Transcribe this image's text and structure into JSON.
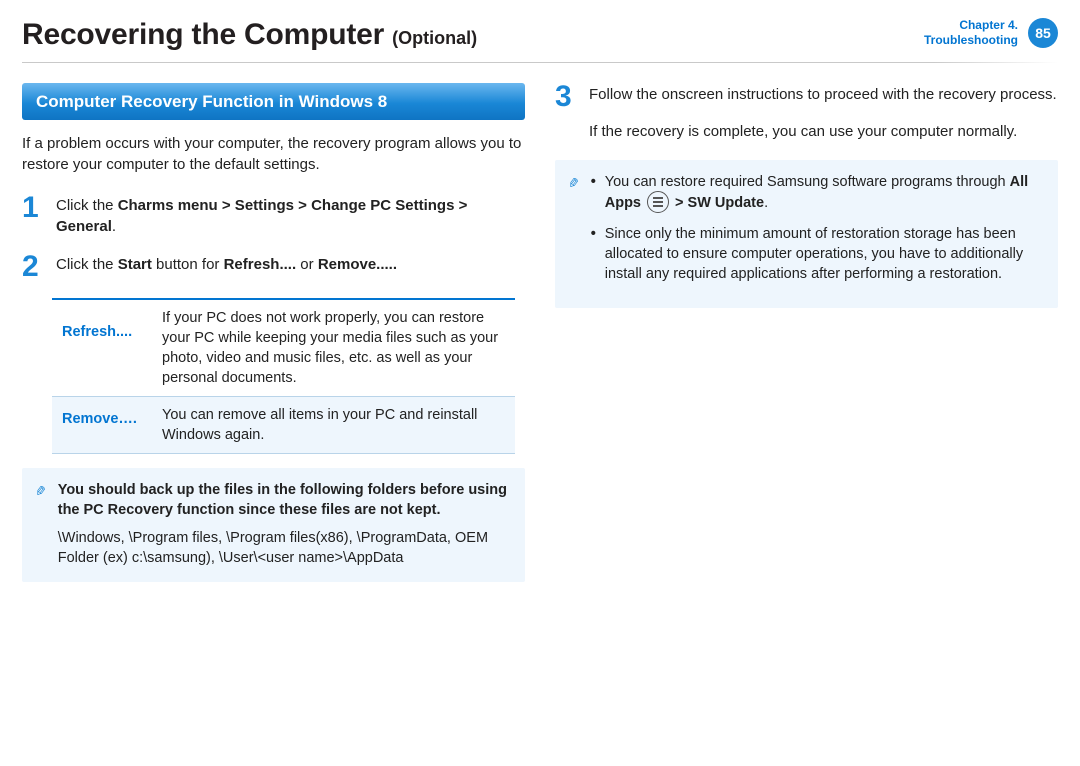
{
  "header": {
    "title": "Recovering the Computer",
    "subtitle": "(Optional)",
    "chapter_line1": "Chapter 4.",
    "chapter_line2": "Troubleshooting",
    "page_number": "85"
  },
  "left": {
    "banner": "Computer Recovery Function in Windows 8",
    "intro": "If a problem occurs with your computer, the recovery program allows you to restore your computer to the default settings.",
    "step1_pre": "Click the ",
    "step1_bold": "Charms menu > Settings > Change PC Settings > General",
    "step1_post": ".",
    "step2_pre": "Click the ",
    "step2_b1": "Start",
    "step2_mid1": " button for ",
    "step2_b2": "Refresh....",
    "step2_mid2": " or ",
    "step2_b3": "Remove.....",
    "table": {
      "refresh_label": "Refresh....",
      "refresh_desc": "If your PC does not work properly, you can restore your PC while keeping your media files such as your photo, video and music files, etc. as well as your personal documents.",
      "remove_label": "Remove….",
      "remove_desc": "You can remove all items in your PC and reinstall Windows again."
    },
    "note": {
      "bold": "You should back up the files in the following folders before using the PC Recovery function since these files are not kept.",
      "paths": "\\Windows, \\Program files, \\Program files(x86), \\ProgramData, OEM Folder (ex) c:\\samsung), \\User\\<user name>\\AppData"
    }
  },
  "right": {
    "step3_line1": "Follow the onscreen instructions to proceed with the recovery process.",
    "step3_line2": "If the recovery is complete, you can use your computer normally.",
    "note_items": {
      "item1_pre": "You can restore required Samsung software programs through ",
      "item1_b1": "All Apps",
      "item1_gt": " > ",
      "item1_b2": "SW Update",
      "item1_post": ".",
      "item2": "Since only the minimum amount of restoration storage has been allocated to ensure computer operations, you have to additionally install any required applications after performing a restoration."
    }
  }
}
